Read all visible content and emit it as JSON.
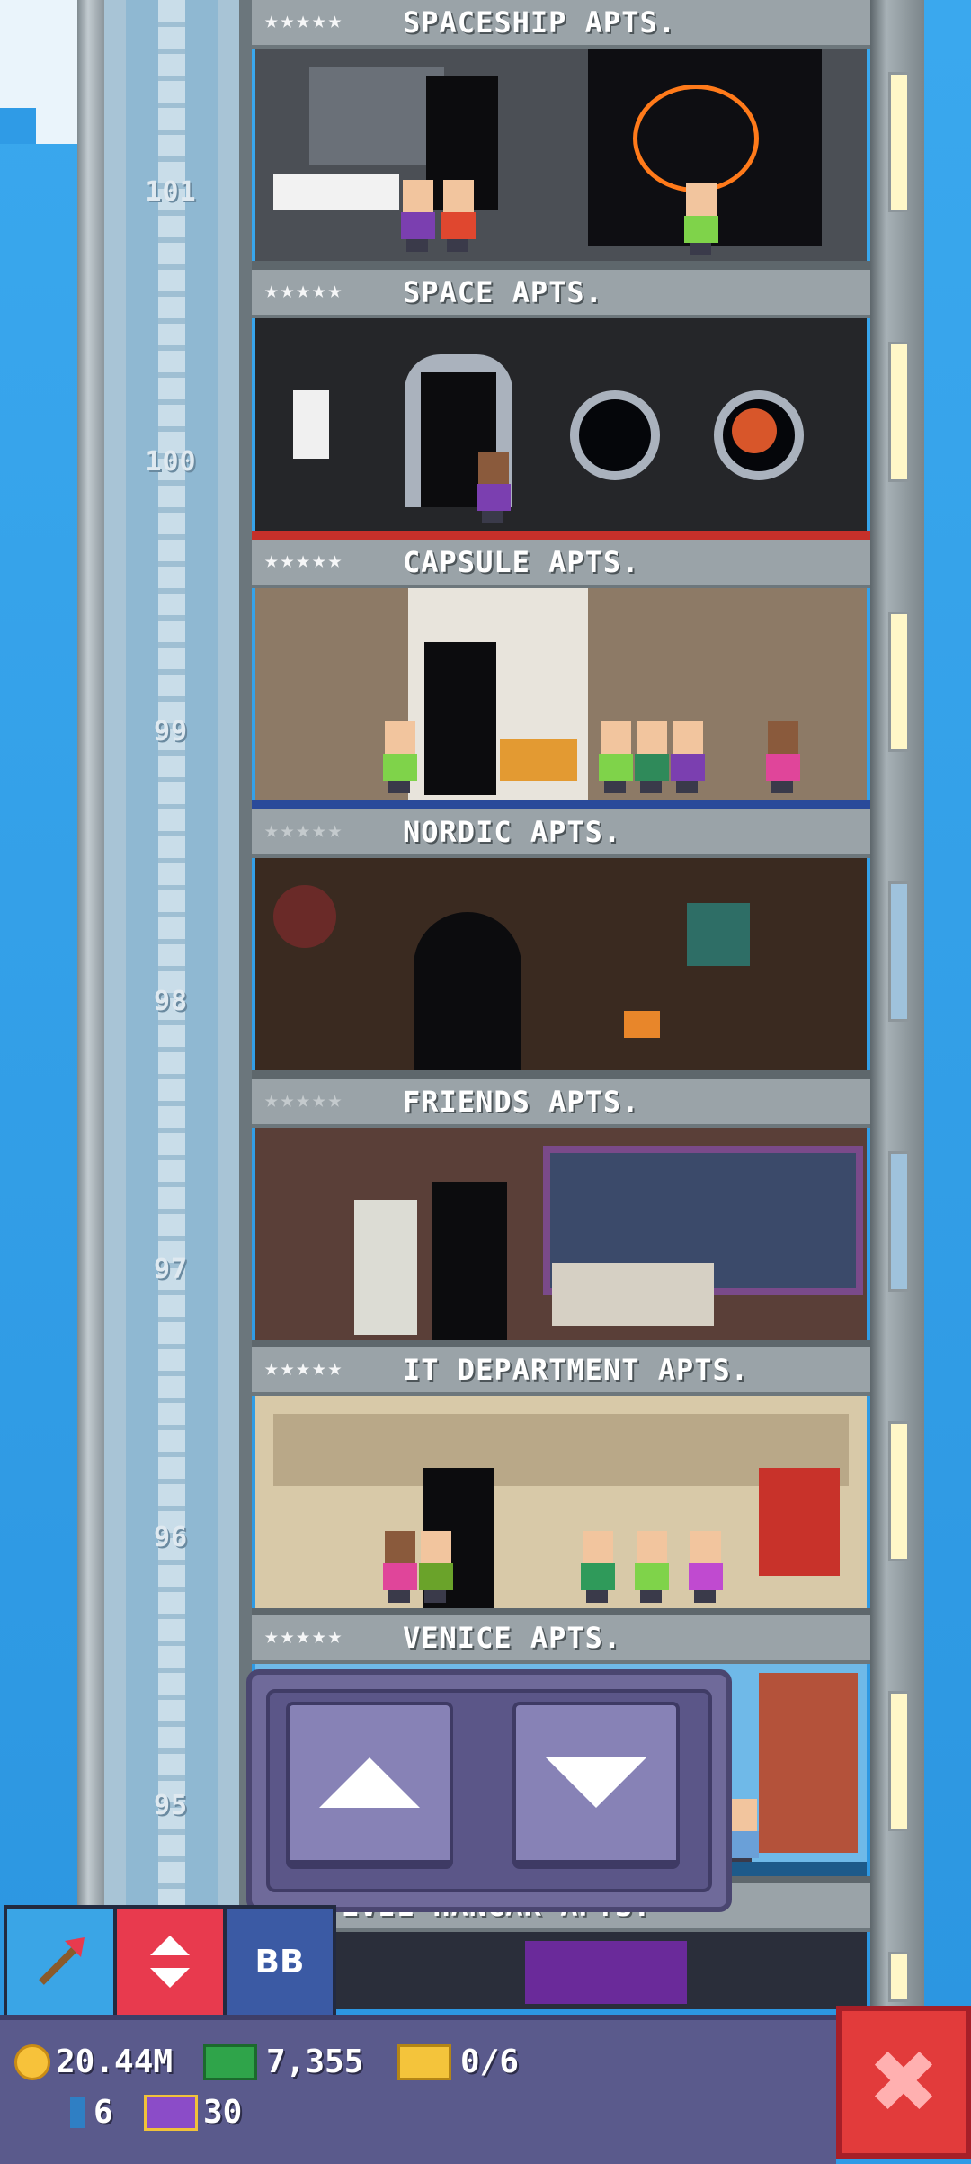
{
  "floors": [
    {
      "name": "SPACESHIP APTS.",
      "number": "101",
      "stars": "★★★★★",
      "stars_lit": true,
      "wall": "#4b4f55"
    },
    {
      "name": "SPACE APTS.",
      "number": "100",
      "stars": "★★★★★",
      "stars_lit": true,
      "wall": "#252629"
    },
    {
      "name": "CAPSULE APTS.",
      "number": "99",
      "stars": "★★★★★",
      "stars_lit": true,
      "wall": "#e8e4dc"
    },
    {
      "name": "NORDIC APTS.",
      "number": "98",
      "stars": "★★★★★",
      "stars_lit": false,
      "wall": "#3a2a20"
    },
    {
      "name": "FRIENDS APTS.",
      "number": "97",
      "stars": "★★★★★",
      "stars_lit": false,
      "wall": "#5a3f38"
    },
    {
      "name": "IT DEPARTMENT APTS.",
      "number": "96",
      "stars": "★★★★★",
      "stars_lit": true,
      "wall": "#d8c9a8"
    },
    {
      "name": "VENICE APTS.",
      "number": "95",
      "stars": "★★★★★",
      "stars_lit": true,
      "wall": "#6fb9e8"
    }
  ],
  "partial_floor_label": "EVIL HANGAR APTS.",
  "toolbar": {
    "raise_icon": "pickaxe-icon",
    "elevator_icon": "elevator-updown-icon",
    "bb_label": "BB"
  },
  "elevator_controls": {
    "up_icon": "arrow-up-icon",
    "down_icon": "arrow-down-icon"
  },
  "hud": {
    "coins": "20.44M",
    "bux": "7,355",
    "tickets": "0/6",
    "bitizens": "6",
    "tower_bux": "30"
  },
  "close_icon": "close-icon",
  "colors": {
    "sky": "#2f9be6",
    "hud_bg": "#5a5a8c",
    "close_bg": "#e23b3b",
    "elevator_btn": "#e83a4e",
    "raise_btn": "#3aa5e6",
    "bb_btn": "#3b5aa4"
  }
}
